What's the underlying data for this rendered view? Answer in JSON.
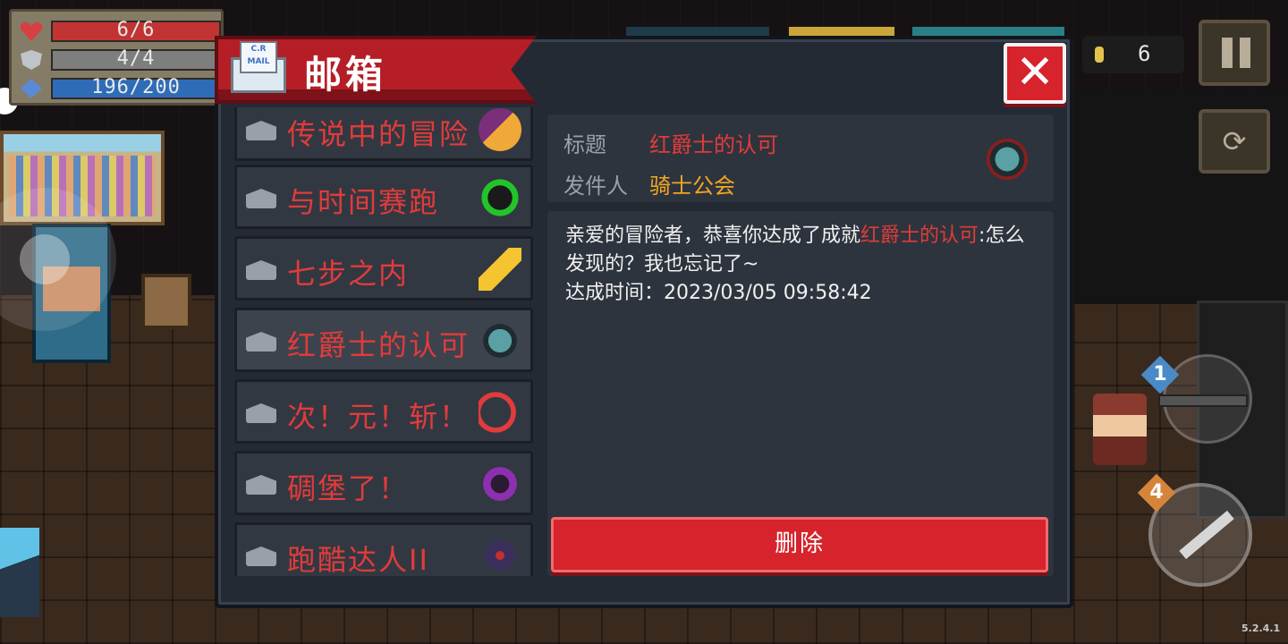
{
  "hud": {
    "health": "6/6",
    "armor": "4/4",
    "energy": "196/200",
    "coins": "6",
    "version": "5.2.4.1"
  },
  "mailbox": {
    "title": "邮箱",
    "mail_icon_text": "C.R MAIL",
    "close_label": "✕",
    "items": [
      {
        "label": "传说中的冒险"
      },
      {
        "label": "与时间赛跑"
      },
      {
        "label": "七步之内"
      },
      {
        "label": "红爵士的认可"
      },
      {
        "label": "次！元！斩！"
      },
      {
        "label": "碉堡了！"
      },
      {
        "label": "跑酷达人II"
      }
    ],
    "selected_index": 3,
    "detail": {
      "title_key": "标题",
      "title_value": "红爵士的认可",
      "sender_key": "发件人",
      "sender_value": "骑士公会",
      "body_prefix": "亲爱的冒险者，恭喜你达成了成就",
      "body_highlight": "红爵士的认可",
      "body_suffix": ":怎么发现的？我也忘记了~",
      "time_label": "达成时间：2023/03/05 09:58:42"
    },
    "delete_label": "删除"
  },
  "colors": {
    "accent_red": "#d6232c",
    "mail_label": "#e23b3b",
    "sender_gold": "#f2a623"
  }
}
